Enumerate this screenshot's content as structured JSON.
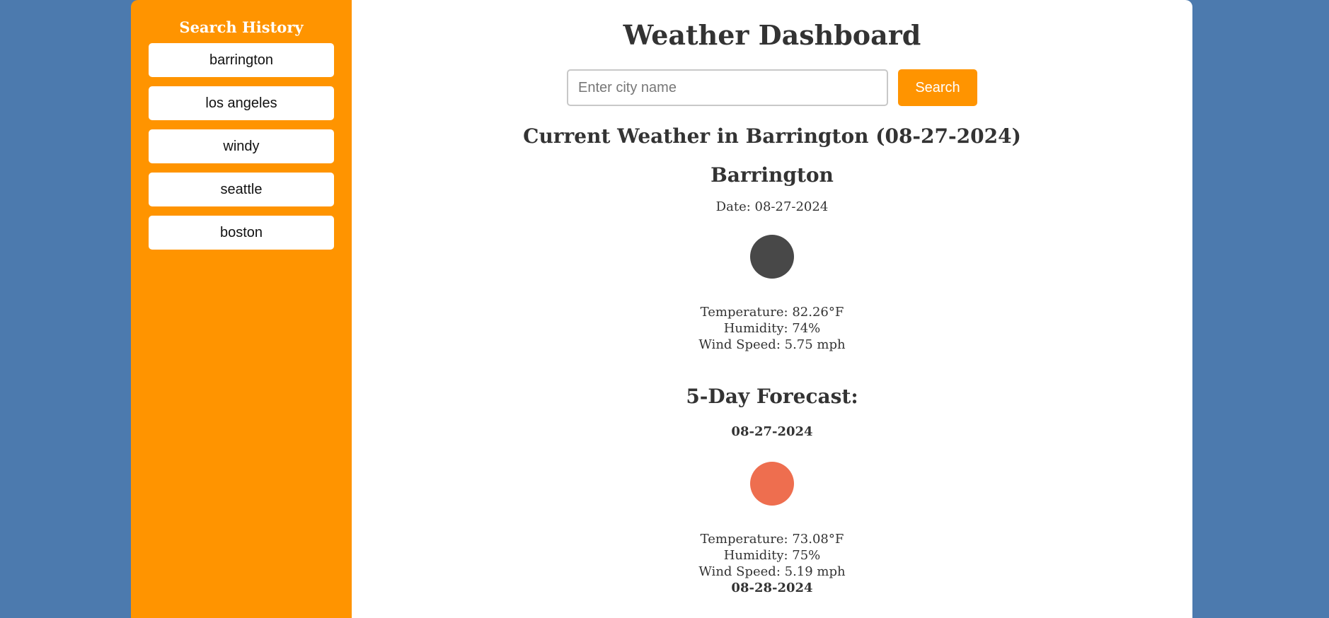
{
  "sidebar": {
    "title": "Search History",
    "items": [
      "barrington",
      "los angeles",
      "windy",
      "seattle",
      "boston"
    ]
  },
  "header": {
    "title": "Weather Dashboard"
  },
  "search": {
    "placeholder": "Enter city name",
    "value": "",
    "button_label": "Search"
  },
  "current": {
    "heading": "Current Weather in Barrington (08-27-2024)",
    "city": "Barrington",
    "date_line": "Date: 08-27-2024",
    "icon": "weather-icon",
    "icon_color": "#484848",
    "temperature": "Temperature: 82.26°F",
    "humidity": "Humidity: 74%",
    "wind": "Wind Speed: 5.75 mph"
  },
  "forecast": {
    "heading": "5-Day Forecast:",
    "days": [
      {
        "date": "08-27-2024",
        "icon": "weather-icon",
        "icon_color": "#ee6e4f",
        "temperature": "Temperature: 73.08°F",
        "humidity": "Humidity: 75%",
        "wind": "Wind Speed: 5.19 mph"
      },
      {
        "date": "08-28-2024"
      }
    ]
  },
  "colors": {
    "background": "#4c7aae",
    "accent": "#ff9400",
    "panel": "#ffffff"
  }
}
